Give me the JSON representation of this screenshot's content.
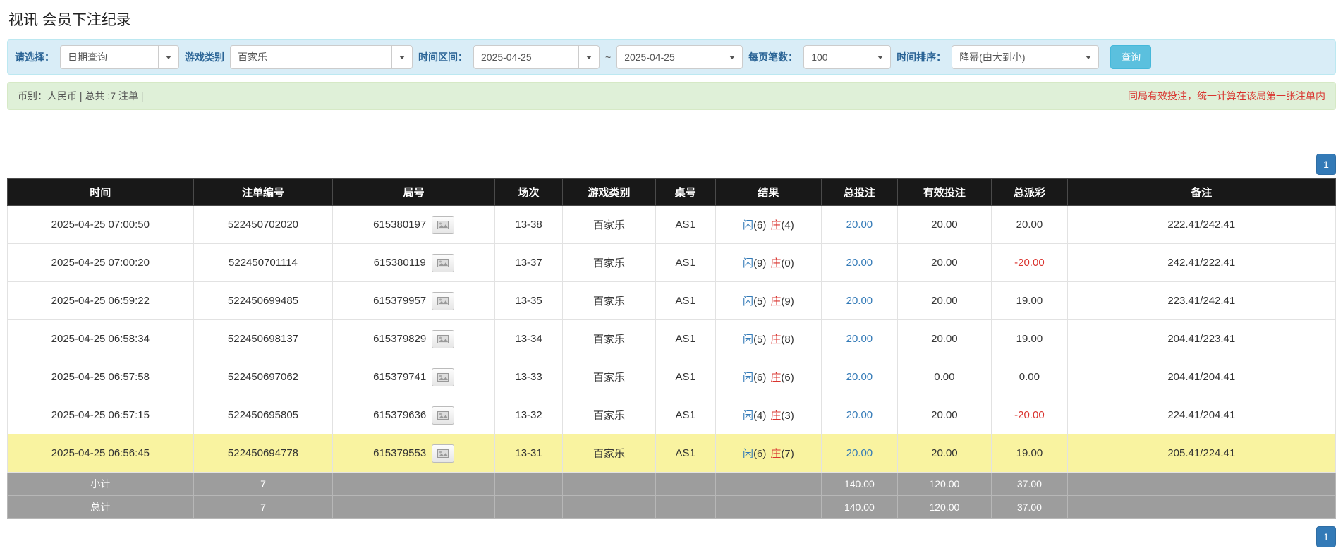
{
  "page": {
    "title": "视讯 会员下注纪录"
  },
  "colors": {
    "accent_blue": "#337ab7",
    "label_blue": "#2a6496",
    "danger_red": "#d9342f",
    "filter_bg": "#d9edf7",
    "summary_bg": "#dff0d8",
    "search_button_bg": "#5bc0de",
    "table_header_bg": "#181818",
    "table_footer_bg": "#9d9d9d",
    "highlight_row_bg": "#f9f3a0"
  },
  "filters": {
    "select_label": "请选择：",
    "select_value": "日期查询",
    "game_type_label": "游戏类别",
    "game_type_value": "百家乐",
    "time_range_label": "时间区间：",
    "date_from": "2025-04-25",
    "tilde": "~",
    "date_to": "2025-04-25",
    "page_size_label": "每页笔数：",
    "page_size_value": "100",
    "sort_label": "时间排序：",
    "sort_value": "降幂(由大到小)",
    "search_button": "查询"
  },
  "summary": {
    "left": "币别：人民币 | 总共 :7 注单 |",
    "right_notice": "同局有效投注，统一计算在该局第一张注单内"
  },
  "pagination": {
    "page": "1"
  },
  "table": {
    "headers": [
      "时间",
      "注单编号",
      "局号",
      "场次",
      "游戏类别",
      "桌号",
      "结果",
      "总投注",
      "有效投注",
      "总派彩",
      "备注"
    ],
    "rows": [
      {
        "time": "2025-04-25 07:00:50",
        "bet_id": "522450702020",
        "round": "615380197",
        "session": "13-38",
        "game": "百家乐",
        "table_no": "AS1",
        "player": "闲",
        "player_pts": "(6)",
        "banker": "庄",
        "banker_pts": "(4)",
        "total_bet": "20.00",
        "valid_bet": "20.00",
        "payout": "20.00",
        "remark": "222.41/242.41",
        "highlight": false
      },
      {
        "time": "2025-04-25 07:00:20",
        "bet_id": "522450701114",
        "round": "615380119",
        "session": "13-37",
        "game": "百家乐",
        "table_no": "AS1",
        "player": "闲",
        "player_pts": "(9)",
        "banker": "庄",
        "banker_pts": "(0)",
        "total_bet": "20.00",
        "valid_bet": "20.00",
        "payout": "-20.00",
        "remark": "242.41/222.41",
        "highlight": false
      },
      {
        "time": "2025-04-25 06:59:22",
        "bet_id": "522450699485",
        "round": "615379957",
        "session": "13-35",
        "game": "百家乐",
        "table_no": "AS1",
        "player": "闲",
        "player_pts": "(5)",
        "banker": "庄",
        "banker_pts": "(9)",
        "total_bet": "20.00",
        "valid_bet": "20.00",
        "payout": "19.00",
        "remark": "223.41/242.41",
        "highlight": false
      },
      {
        "time": "2025-04-25 06:58:34",
        "bet_id": "522450698137",
        "round": "615379829",
        "session": "13-34",
        "game": "百家乐",
        "table_no": "AS1",
        "player": "闲",
        "player_pts": "(5)",
        "banker": "庄",
        "banker_pts": "(8)",
        "total_bet": "20.00",
        "valid_bet": "20.00",
        "payout": "19.00",
        "remark": "204.41/223.41",
        "highlight": false
      },
      {
        "time": "2025-04-25 06:57:58",
        "bet_id": "522450697062",
        "round": "615379741",
        "session": "13-33",
        "game": "百家乐",
        "table_no": "AS1",
        "player": "闲",
        "player_pts": "(6)",
        "banker": "庄",
        "banker_pts": "(6)",
        "total_bet": "20.00",
        "valid_bet": "0.00",
        "payout": "0.00",
        "remark": "204.41/204.41",
        "highlight": false
      },
      {
        "time": "2025-04-25 06:57:15",
        "bet_id": "522450695805",
        "round": "615379636",
        "session": "13-32",
        "game": "百家乐",
        "table_no": "AS1",
        "player": "闲",
        "player_pts": "(4)",
        "banker": "庄",
        "banker_pts": "(3)",
        "total_bet": "20.00",
        "valid_bet": "20.00",
        "payout": "-20.00",
        "remark": "224.41/204.41",
        "highlight": false
      },
      {
        "time": "2025-04-25 06:56:45",
        "bet_id": "522450694778",
        "round": "615379553",
        "session": "13-31",
        "game": "百家乐",
        "table_no": "AS1",
        "player": "闲",
        "player_pts": "(6)",
        "banker": "庄",
        "banker_pts": "(7)",
        "total_bet": "20.00",
        "valid_bet": "20.00",
        "payout": "19.00",
        "remark": "205.41/224.41",
        "highlight": true
      }
    ],
    "subtotal": {
      "label": "小计",
      "count": "7",
      "total_bet": "140.00",
      "valid_bet": "120.00",
      "payout": "37.00"
    },
    "total": {
      "label": "总计",
      "count": "7",
      "total_bet": "140.00",
      "valid_bet": "120.00",
      "payout": "37.00"
    }
  }
}
